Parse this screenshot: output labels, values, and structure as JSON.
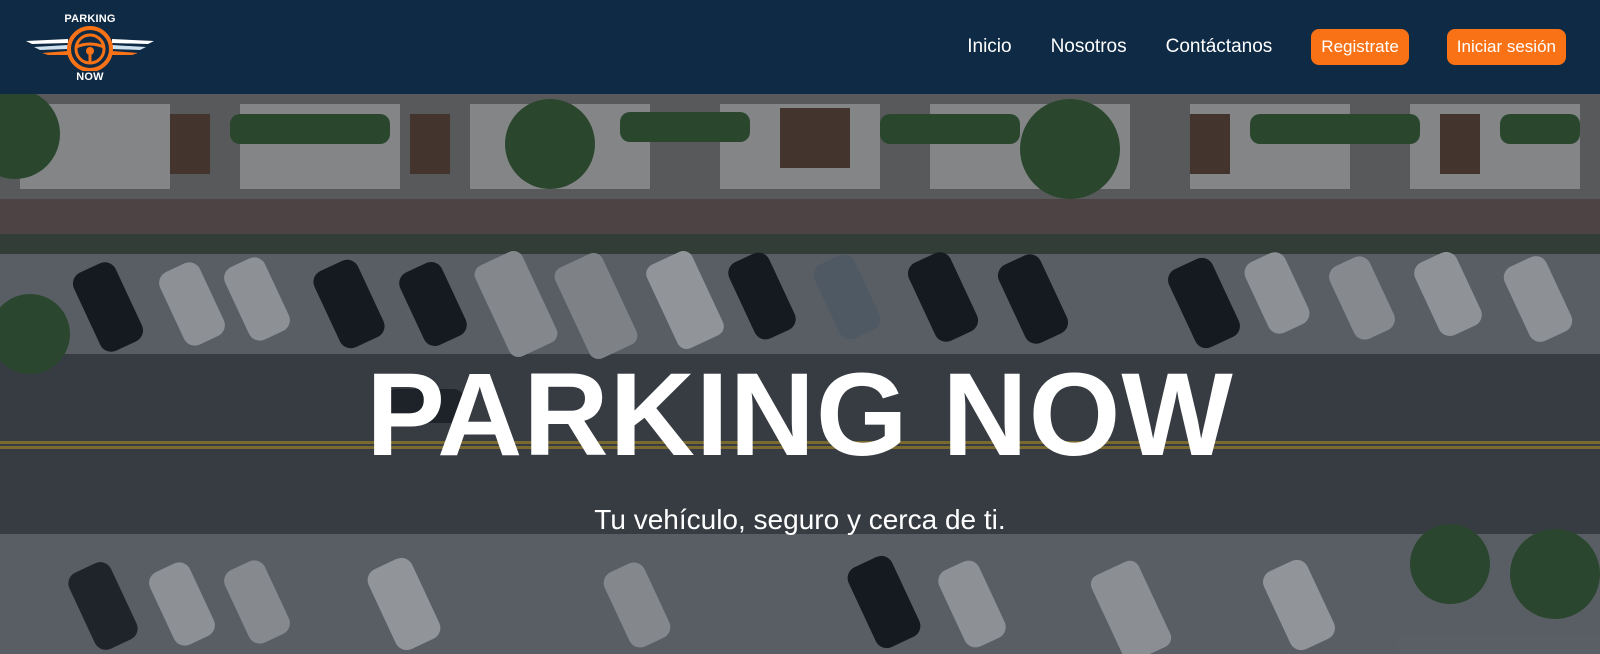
{
  "brand": {
    "logo_top": "PARKING",
    "logo_bottom": "NOW",
    "icon": "steering-wheel-icon",
    "accent_color": "#f97316",
    "nav_color": "#0f2a44"
  },
  "nav": {
    "links": [
      "Inicio",
      "Nosotros",
      "Contáctanos"
    ],
    "register_label": "Registrate",
    "login_label": "Iniciar sesión"
  },
  "hero": {
    "title": "PARKING NOW",
    "subtitle": "Tu vehículo, seguro y cerca de ti."
  }
}
